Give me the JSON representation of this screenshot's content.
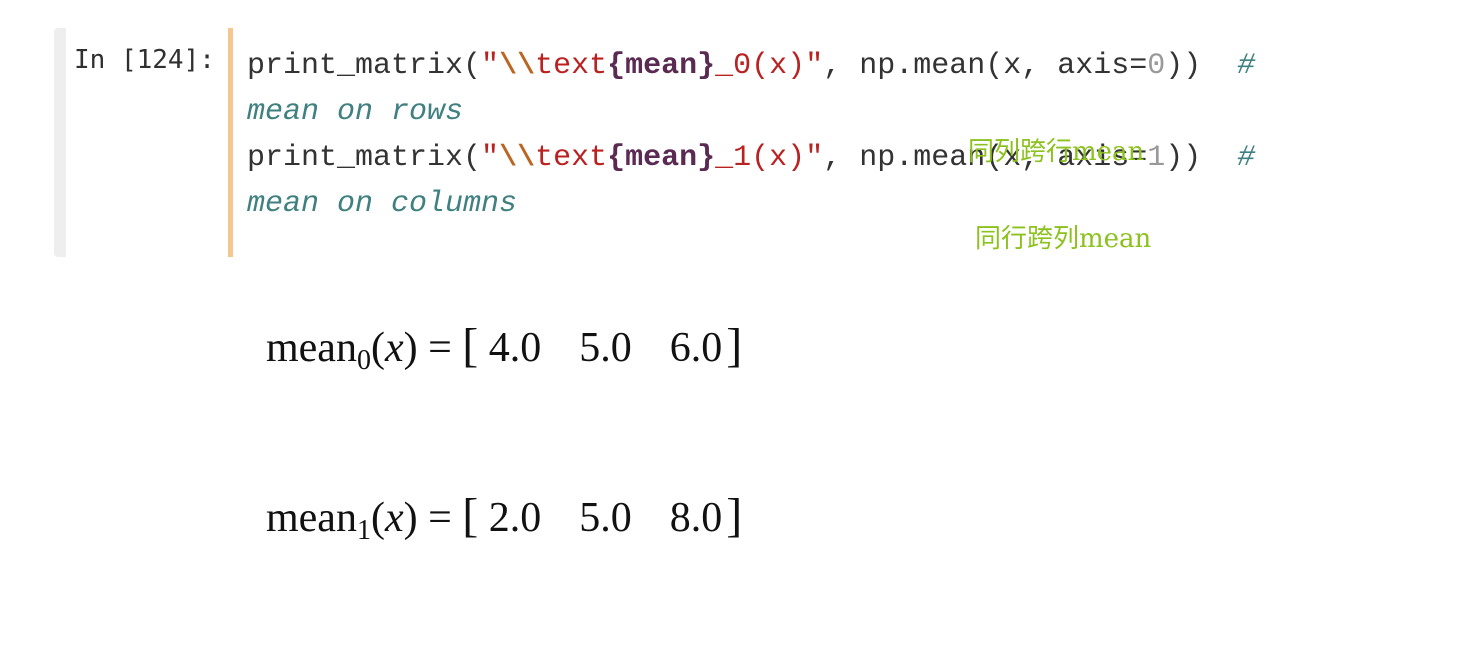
{
  "cell": {
    "prompt": "In [124]:",
    "lines": [
      {
        "func": "print_matrix(",
        "q1": "\"",
        "esc": "\\\\",
        "cmd": "text",
        "brace_open": "{",
        "kw": "mean",
        "brace_close": "}",
        "sub": "_",
        "digit": "0",
        "arg": "(x)",
        "q2": "\"",
        "call": ", np.mean(x, axis=",
        "axis": "0",
        "tail": "))  ",
        "hash": "#"
      },
      {
        "comment": "mean on rows"
      },
      {
        "func": "print_matrix(",
        "q1": "\"",
        "esc": "\\\\",
        "cmd": "text",
        "brace_open": "{",
        "kw": "mean",
        "brace_close": "}",
        "sub": "_",
        "digit": "1",
        "arg": "(x)",
        "q2": "\"",
        "call": ", np.mean(x, axis=",
        "axis": "1",
        "tail": "))  ",
        "hash": "#"
      },
      {
        "comment": "mean on columns"
      }
    ],
    "notes": [
      "同列跨行mean",
      "同行跨列mean"
    ]
  },
  "output": [
    {
      "name": "mean",
      "subscript": "0",
      "open": "(",
      "var": "x",
      "close": ")",
      "equals": " = ",
      "lbracket": "[",
      "values": [
        "4.0",
        "5.0",
        "6.0"
      ],
      "rbracket": "]"
    },
    {
      "name": "mean",
      "subscript": "1",
      "open": "(",
      "var": "x",
      "close": ")",
      "equals": " = ",
      "lbracket": "[",
      "values": [
        "2.0",
        "5.0",
        "8.0"
      ],
      "rbracket": "]"
    }
  ],
  "colors": {
    "string": "#ba2121",
    "escape": "#bb6622",
    "keyword": "#5a2a52",
    "comment": "#408080",
    "number": "#999999",
    "annotation": "#8cc21e",
    "edit_bar": "#f6c690"
  }
}
